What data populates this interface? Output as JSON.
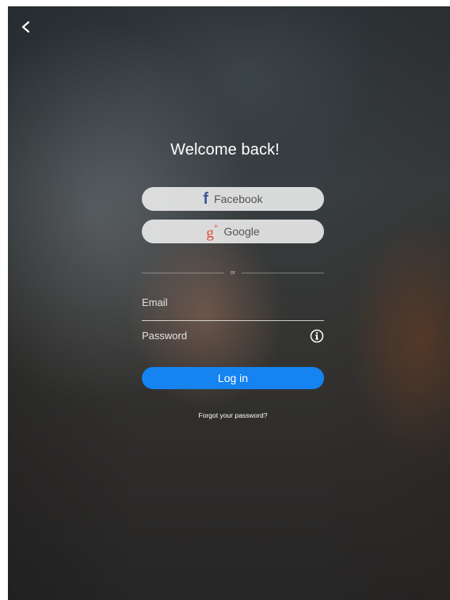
{
  "header": {
    "back_icon": "chevron-left-icon"
  },
  "title": "Welcome back!",
  "social": {
    "facebook": {
      "icon": "f",
      "label": "Facebook",
      "color": "#3b5998"
    },
    "google": {
      "icon": "g",
      "icon_sup": "+",
      "label": "Google",
      "color": "#dd4b39"
    }
  },
  "divider": {
    "label": "or"
  },
  "form": {
    "email": {
      "placeholder": "Email",
      "value": ""
    },
    "password": {
      "placeholder": "Password",
      "value": "",
      "info_icon": "info-icon"
    }
  },
  "login": {
    "label": "Log in",
    "color": "#1583f0"
  },
  "forgot": {
    "label": "Forgot your password?"
  }
}
